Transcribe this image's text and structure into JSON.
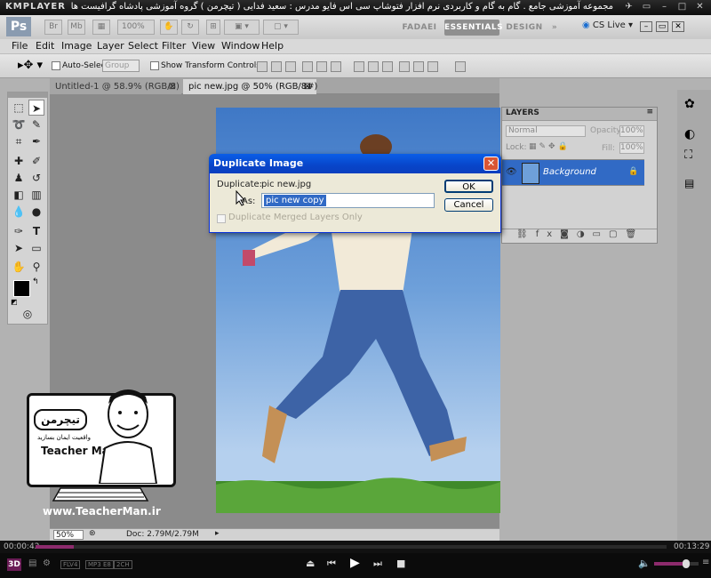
{
  "player": {
    "logo": "KMPLAYER",
    "caption": "مجموعه آموزشی جامع . گام به گام و کاربردی نرم افزار فتوشاپ سی اس فایو  مدرس : سعید فدایی ( تیچرمن ) گروه آموزشی پادشاه گرافیست ها",
    "time_elapsed": "00:00:42",
    "time_total": "00:13:29",
    "progress_fraction": 0.06,
    "badges": [
      "FLV4",
      "MP3 E8",
      "2CH"
    ],
    "mode_label": "3D"
  },
  "photoshop": {
    "logo": "Ps",
    "mini_buttons": [
      "Br",
      "Mb"
    ],
    "zoom_value": "100%",
    "workspaces": [
      "FADAEI",
      "ESSENTIALS",
      "DESIGN"
    ],
    "active_workspace": "ESSENTIALS",
    "cs_live": "CS Live",
    "menu": [
      "File",
      "Edit",
      "Image",
      "Layer",
      "Select",
      "Filter",
      "View",
      "Window",
      "Help"
    ],
    "options": {
      "auto_select_label": "Auto-Select:",
      "auto_select_value": "Group",
      "show_transform_label": "Show Transform Controls"
    },
    "tabs": [
      {
        "label": "Untitled-1 @ 58.9% (RGB/8)",
        "active": false
      },
      {
        "label": "pic new.jpg @ 50% (RGB/8#)",
        "active": true
      }
    ],
    "status": {
      "zoom": "50%",
      "doc": "Doc: 2.79M/2.79M"
    },
    "layers": {
      "tab_label": "LAYERS",
      "blend_mode": "Normal",
      "opacity_label": "Opacity:",
      "opacity_value": "100%",
      "lock_label": "Lock:",
      "fill_label": "Fill:",
      "fill_value": "100%",
      "layer_name": "Background"
    }
  },
  "dialog": {
    "title": "Duplicate Image",
    "duplicate_label": "Duplicate:",
    "duplicate_value": "pic new.jpg",
    "as_label": "As:",
    "as_value": "pic new copy",
    "merged_label": "Duplicate Merged Layers Only",
    "ok_label": "OK",
    "cancel_label": "Cancel"
  },
  "watermark": {
    "logo_text": "تیچرمن",
    "tagline": "واقعیت ایمان بسازید",
    "name": "Teacher Man",
    "url": "www.TeacherMan.ir"
  },
  "colors": {
    "dialog_title": "#0845c9",
    "selection": "#316ac5",
    "progress": "#8d2b6d",
    "sky": "#6ea0da"
  }
}
